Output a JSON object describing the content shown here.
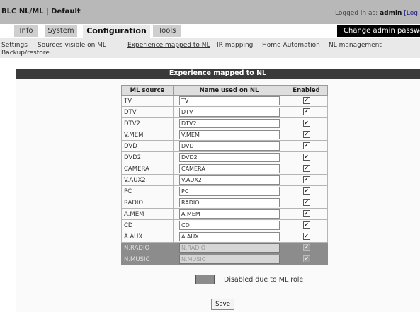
{
  "header": {
    "title": "BLC NL/ML | Default",
    "logged_in_prefix": "Logged in as: ",
    "user": "admin",
    "logout_label": "[Log o"
  },
  "tabs": [
    {
      "label": "Info",
      "active": false
    },
    {
      "label": "System",
      "active": false
    },
    {
      "label": "Configuration",
      "active": true
    },
    {
      "label": "Tools",
      "active": false
    }
  ],
  "admin_button": "Change admin passwor",
  "subnav": [
    {
      "label": "Settings",
      "current": false
    },
    {
      "label": "Sources visible on ML",
      "current": false
    },
    {
      "label": "Experience mapped to NL",
      "current": true
    },
    {
      "label": "IR mapping",
      "current": false
    },
    {
      "label": "Home Automation",
      "current": false
    },
    {
      "label": "NL management",
      "current": false
    },
    {
      "label": "Backup/restore",
      "current": false
    }
  ],
  "panel": {
    "title": "Experience mapped to NL",
    "columns": [
      "ML source",
      "Name used on NL",
      "Enabled"
    ],
    "rows": [
      {
        "source": "TV",
        "name": "TV",
        "enabled": true,
        "disabled": false
      },
      {
        "source": "DTV",
        "name": "DTV",
        "enabled": true,
        "disabled": false
      },
      {
        "source": "DTV2",
        "name": "DTV2",
        "enabled": true,
        "disabled": false
      },
      {
        "source": "V.MEM",
        "name": "V.MEM",
        "enabled": true,
        "disabled": false
      },
      {
        "source": "DVD",
        "name": "DVD",
        "enabled": true,
        "disabled": false
      },
      {
        "source": "DVD2",
        "name": "DVD2",
        "enabled": true,
        "disabled": false
      },
      {
        "source": "CAMERA",
        "name": "CAMERA",
        "enabled": true,
        "disabled": false
      },
      {
        "source": "V.AUX2",
        "name": "V.AUX2",
        "enabled": true,
        "disabled": false
      },
      {
        "source": "PC",
        "name": "PC",
        "enabled": true,
        "disabled": false
      },
      {
        "source": "RADIO",
        "name": "RADIO",
        "enabled": true,
        "disabled": false
      },
      {
        "source": "A.MEM",
        "name": "A.MEM",
        "enabled": true,
        "disabled": false
      },
      {
        "source": "CD",
        "name": "CD",
        "enabled": true,
        "disabled": false
      },
      {
        "source": "A.AUX",
        "name": "A.AUX",
        "enabled": true,
        "disabled": false
      },
      {
        "source": "N.RADIO",
        "name": "N.RADIO",
        "enabled": true,
        "disabled": true
      },
      {
        "source": "N.MUSIC",
        "name": "N.MUSIC",
        "enabled": true,
        "disabled": true
      }
    ],
    "legend": "Disabled due to ML role",
    "save_label": "Save"
  },
  "colors": {
    "header_bg": "#b8b8b8",
    "panel_title_bg": "#3a3a3a",
    "disabled_row_bg": "#8c8c8c",
    "admin_button_bg": "#000000"
  },
  "icons": {
    "checkbox_checked": "check-icon"
  }
}
